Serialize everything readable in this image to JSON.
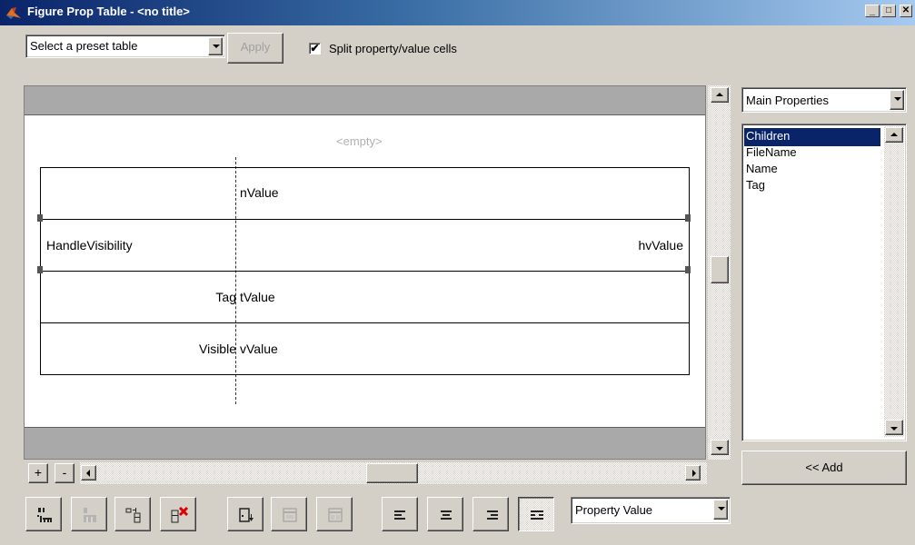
{
  "window": {
    "title": "Figure Prop Table - <no title>",
    "controls": {
      "minimize": "_",
      "maximize": "□",
      "close": "✕"
    }
  },
  "toolbar": {
    "preset_select": {
      "selected": "Select a preset table"
    },
    "apply_label": "Apply",
    "split_checkbox": {
      "label": "Split property/value cells",
      "checked": true,
      "mark": "✔"
    }
  },
  "canvas": {
    "empty_label": "<empty>",
    "rows": [
      {
        "property": "",
        "value": "nValue"
      },
      {
        "property": "HandleVisibility",
        "value": "hvValue"
      },
      {
        "property": "Tag",
        "value": "tValue"
      },
      {
        "property": "Visible",
        "value": "vValue"
      }
    ]
  },
  "scroll_controls": {
    "add_label": "+",
    "remove_label": "-"
  },
  "right_panel": {
    "category_select": {
      "selected": "Main Properties"
    },
    "properties": [
      "Children",
      "FileName",
      "Name",
      "Tag"
    ],
    "selected_index": 0,
    "add_button_label": "<< Add"
  },
  "bottom_toolbar": {
    "buttons": [
      {
        "icon": "insert-property-icon",
        "enabled": true
      },
      {
        "icon": "insert-property-disabled-icon",
        "enabled": false
      },
      {
        "icon": "insert-column-icon",
        "enabled": true
      },
      {
        "icon": "delete-row-icon",
        "enabled": true
      },
      {
        "icon": "insert-row-icon",
        "enabled": true
      },
      {
        "icon": "cell-format-icon",
        "enabled": false
      },
      {
        "icon": "merge-cells-icon",
        "enabled": false
      },
      {
        "icon": "align-left-icon",
        "enabled": true
      },
      {
        "icon": "align-center-icon",
        "enabled": true
      },
      {
        "icon": "align-right-icon",
        "enabled": true
      },
      {
        "icon": "align-split-icon",
        "enabled": true,
        "pressed": true
      }
    ],
    "display_select": {
      "selected": "Property Value"
    }
  },
  "colors": {
    "title_start": "#0a246a",
    "title_end": "#a6caf0",
    "selection": "#0a246a",
    "window_bg": "#d4d0c8",
    "band_gray": "#a9a9a9"
  }
}
